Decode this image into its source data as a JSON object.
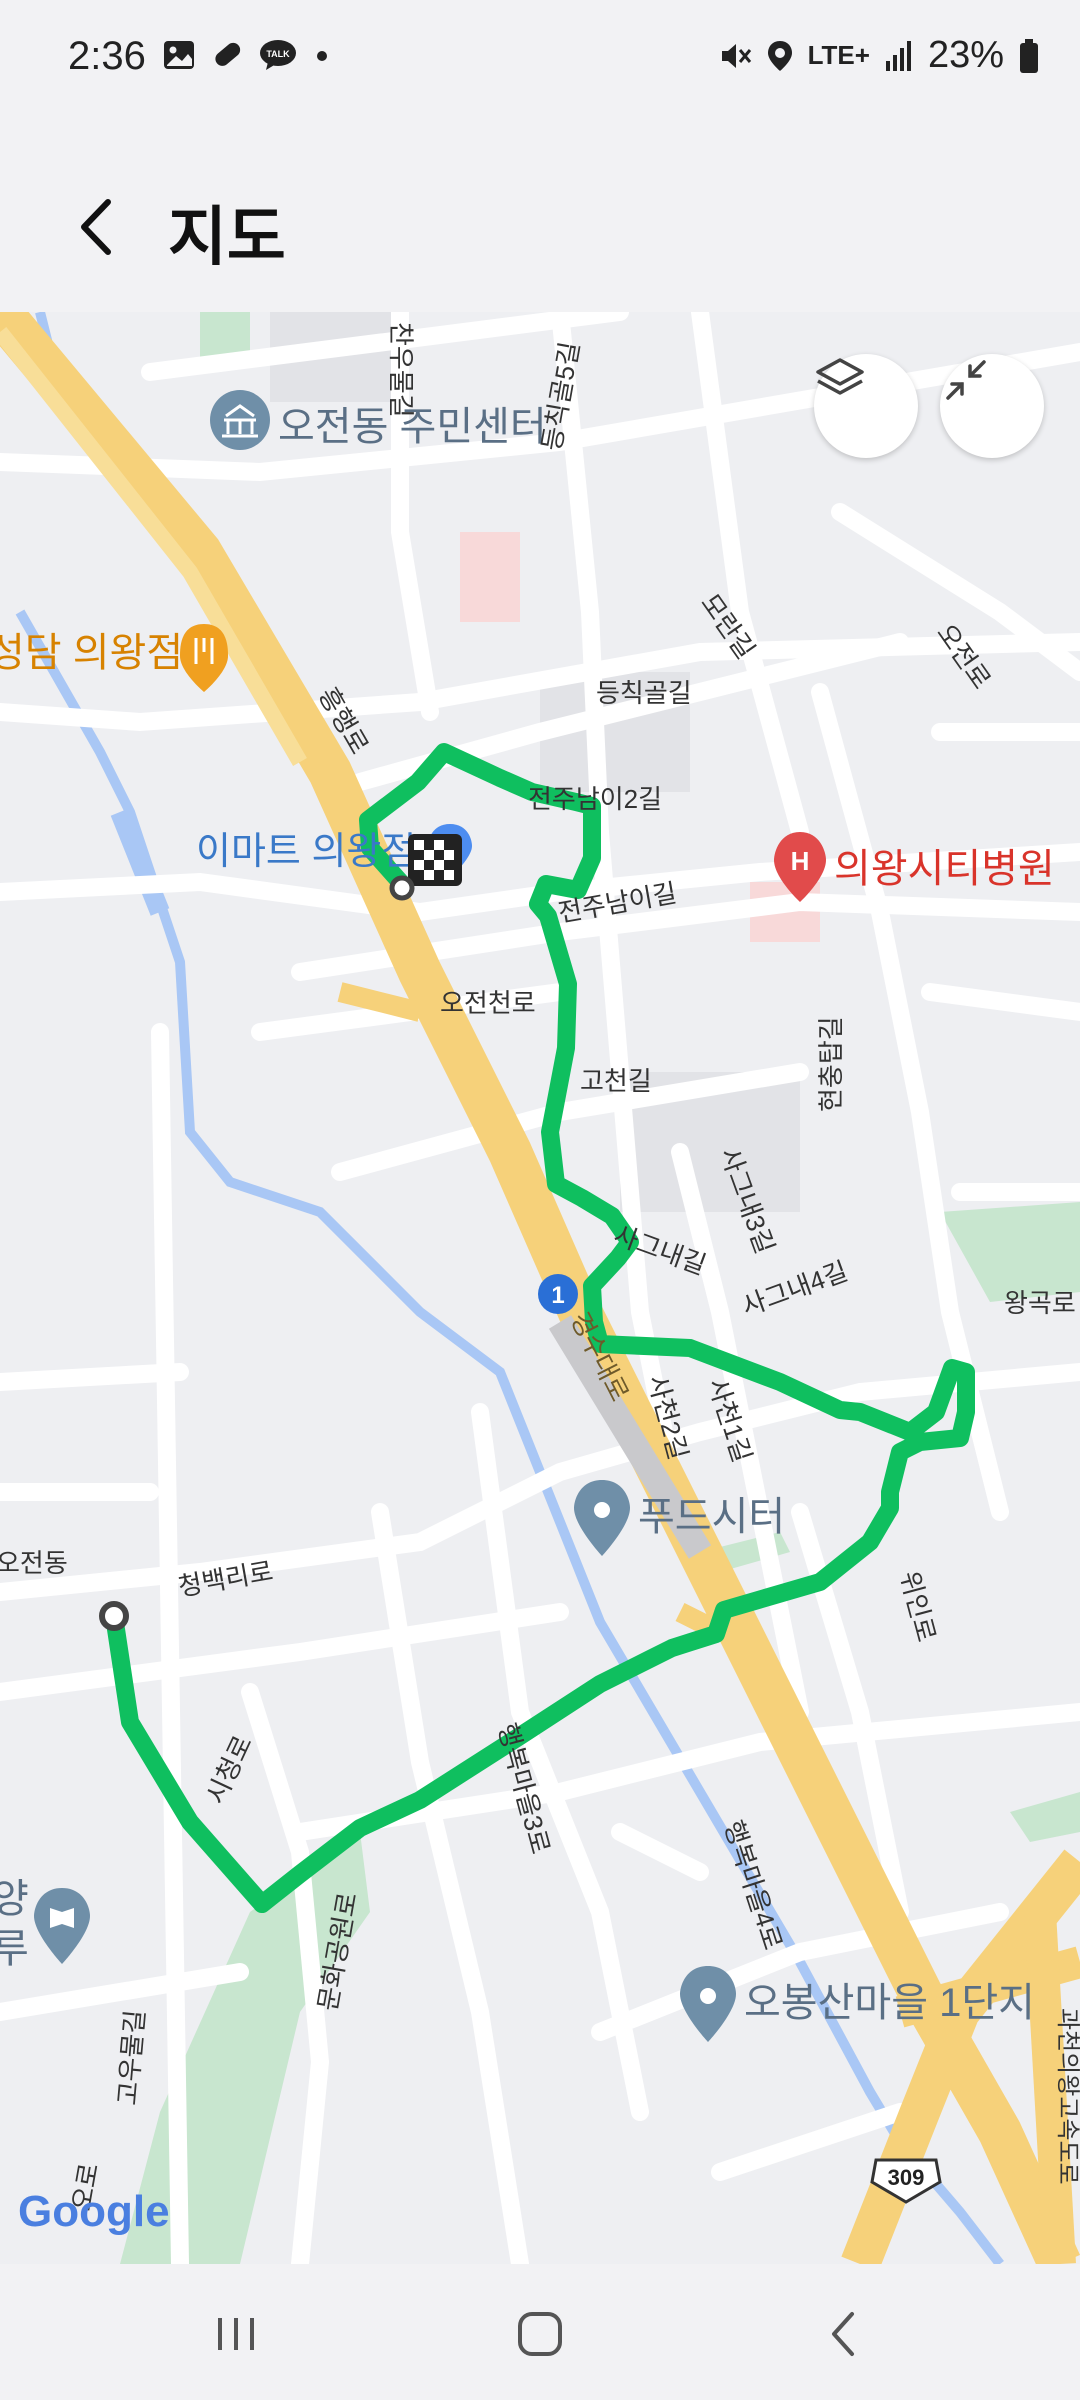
{
  "status_bar": {
    "time": "2:36",
    "network": "LTE+",
    "battery": "23%",
    "left_icons": [
      "gallery-icon",
      "pill-icon",
      "talk-icon",
      "dot-icon"
    ],
    "right_icons": [
      "mute-icon",
      "location-icon",
      "lte-icon",
      "signal-icon",
      "battery-icon"
    ]
  },
  "header": {
    "title": "지도",
    "back_icon": "chevron-left-icon"
  },
  "map": {
    "route_color": "#0fbf5f",
    "controls": {
      "layers_icon": "layers-icon",
      "collapse_icon": "collapse-icon"
    },
    "places": {
      "community_center": "오전동 주민센터",
      "restaurant": "성담 의왕점",
      "emart": "이마트 의왕점",
      "hospital": "의왕시티병원",
      "food_city": "푸드시터",
      "obongsan": "오봉산마을 1단지",
      "library": "양\n루"
    },
    "roads": {
      "chanubuldeul": "찬우물길",
      "deungchikgol5": "등칙골5길",
      "deungchikgol": "등칙골길",
      "moranl": "모란길",
      "ojeonro": "오전로",
      "heunghaengro": "흥행로",
      "jeonjunam2": "전주남이2길",
      "jeonjunam": "전주남이길",
      "ojeoncheon": "오전천로",
      "gocheon": "고천길",
      "hyeonchung": "현충탑길",
      "sagunae3": "사그내3길",
      "sagunae": "사그내길",
      "sagunae4": "사그내4길",
      "wanggok": "왕곡로",
      "gyeongsu": "경수대로",
      "sacheon2": "사천2길",
      "sacheon1": "사천1길",
      "cheongbaek": "청백리로",
      "ojeondong": "오전동",
      "sicheong": "시청로",
      "haengbok3": "행복마을3로",
      "haengbok4": "행복마을4로",
      "uiin": "위인로",
      "munhwagongwon": "문화공원로",
      "goumul": "고우물길",
      "bottom_left": "오로",
      "right_edge": "과천의왕고속도로"
    },
    "route_shields": {
      "national": "1",
      "highway": "309"
    },
    "attribution": "Google"
  },
  "nav_bar": {
    "recents": "recents-icon",
    "home": "home-icon",
    "back": "back-icon"
  }
}
